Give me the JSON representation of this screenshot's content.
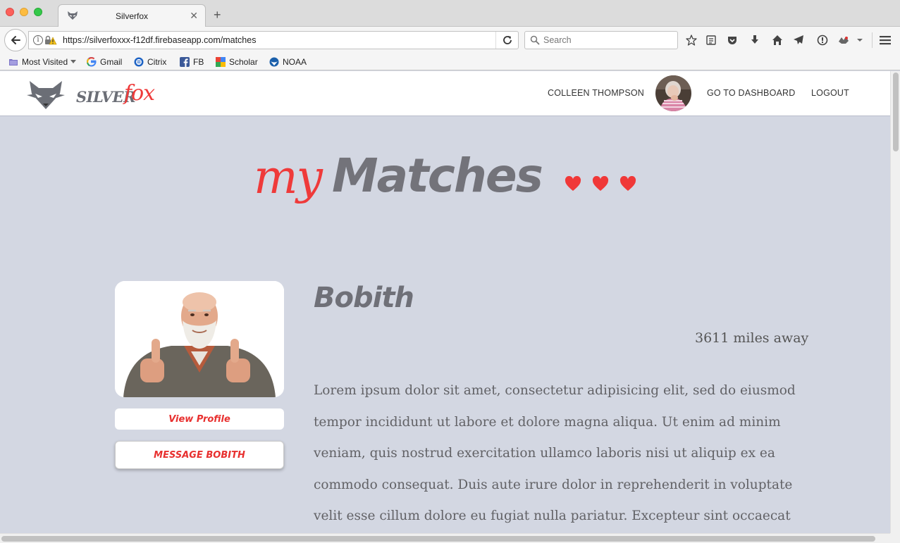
{
  "browser": {
    "tab_title": "Silverfox",
    "url_scheme": "https://",
    "url_host": "silverfoxxx-f12df.firebaseapp.com",
    "url_path": "/matches",
    "search_placeholder": "Search",
    "bookmarks": [
      {
        "label": "Most Visited",
        "icon": "folder-icon"
      },
      {
        "label": "Gmail",
        "icon": "google-icon"
      },
      {
        "label": "Citrix",
        "icon": "citrix-icon"
      },
      {
        "label": "FB",
        "icon": "facebook-icon"
      },
      {
        "label": "Scholar",
        "icon": "scholar-icon"
      },
      {
        "label": "NOAA",
        "icon": "noaa-icon"
      }
    ]
  },
  "header": {
    "brand_silver": "SILVER",
    "brand_fox": "fox",
    "user_name": "COLLEEN THOMPSON",
    "dashboard_label": "GO TO DASHBOARD",
    "logout_label": "LOGOUT"
  },
  "page": {
    "heading_my": "my",
    "heading_main": "Matches",
    "heart_count": 3
  },
  "match": {
    "name": "Bobith",
    "distance": "3611 miles away",
    "view_profile_label": "View Profile",
    "message_label": "MESSAGE BOBITH",
    "bio": "Lorem ipsum dolor sit amet, consectetur adipisicing elit, sed do eiusmod tempor incididunt ut labore et dolore magna aliqua. Ut enim ad minim veniam, quis nostrud exercitation ullamco laboris nisi ut aliquip ex ea commodo consequat. Duis aute irure dolor in reprehenderit in voluptate velit esse cillum dolore eu fugiat nulla pariatur. Excepteur sint occaecat"
  },
  "colors": {
    "accent_red": "#ef3a3a",
    "page_bg": "#d3d7e2",
    "heading_gray": "#73737a"
  }
}
